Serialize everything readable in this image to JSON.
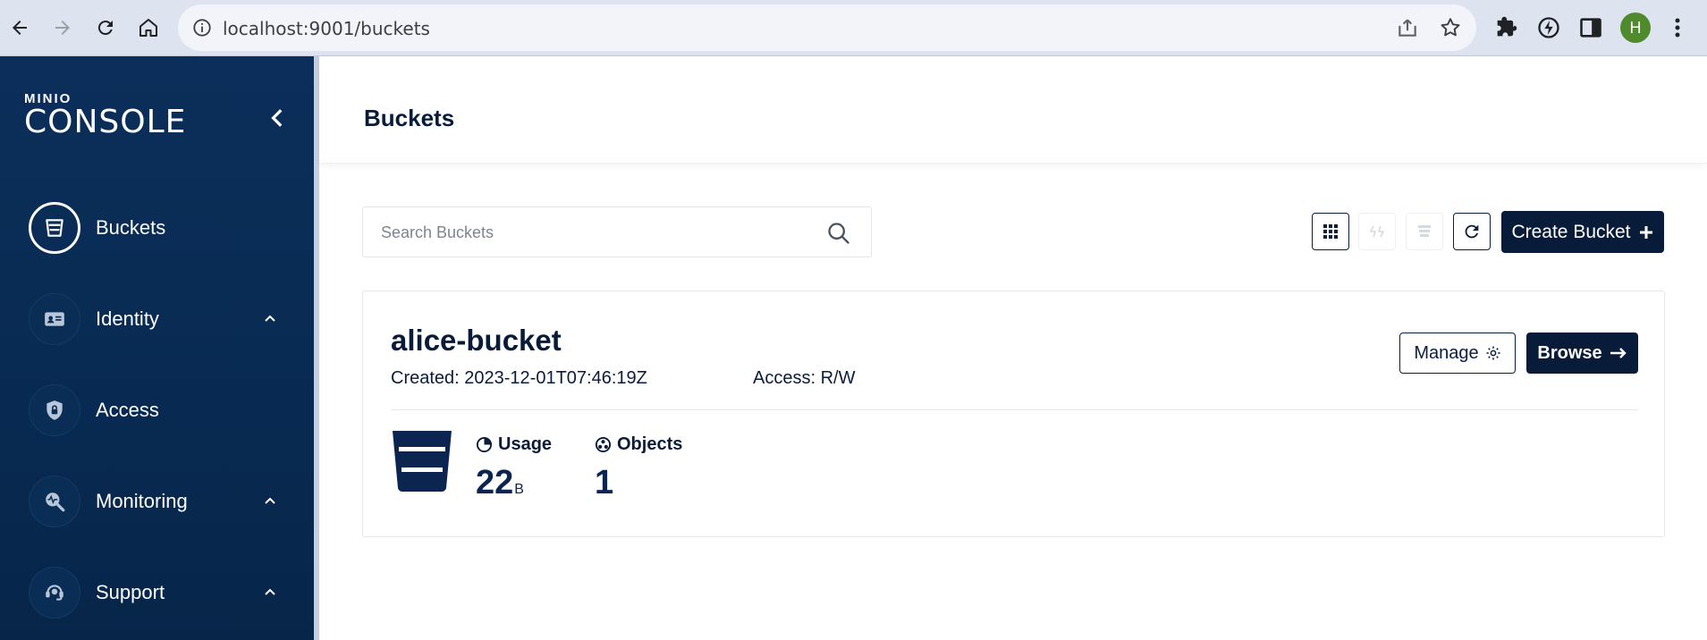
{
  "browser": {
    "url": "localhost:9001/buckets",
    "profile_initial": "H"
  },
  "sidebar": {
    "logo_top": "MINIO",
    "logo_bottom": "CONSOLE",
    "items": [
      {
        "label": "Buckets",
        "active": true
      },
      {
        "label": "Identity",
        "expandable": true
      },
      {
        "label": "Access"
      },
      {
        "label": "Monitoring",
        "expandable": true
      },
      {
        "label": "Support",
        "expandable": true
      }
    ]
  },
  "header": {
    "title": "Buckets"
  },
  "toolbar": {
    "search_placeholder": "Search Buckets",
    "create_label": "Create Bucket"
  },
  "bucket": {
    "name": "alice-bucket",
    "created": "Created: 2023-12-01T07:46:19Z",
    "access": "Access: R/W",
    "manage_label": "Manage",
    "browse_label": "Browse",
    "usage_label": "Usage",
    "usage_value": "22",
    "usage_unit": "B",
    "objects_label": "Objects",
    "objects_value": "1"
  },
  "colors": {
    "sidebar_bg": "#0b2f5a",
    "primary": "#081c3a",
    "chrome_bg": "#dee3f0",
    "avatar": "#4f8a2d"
  }
}
